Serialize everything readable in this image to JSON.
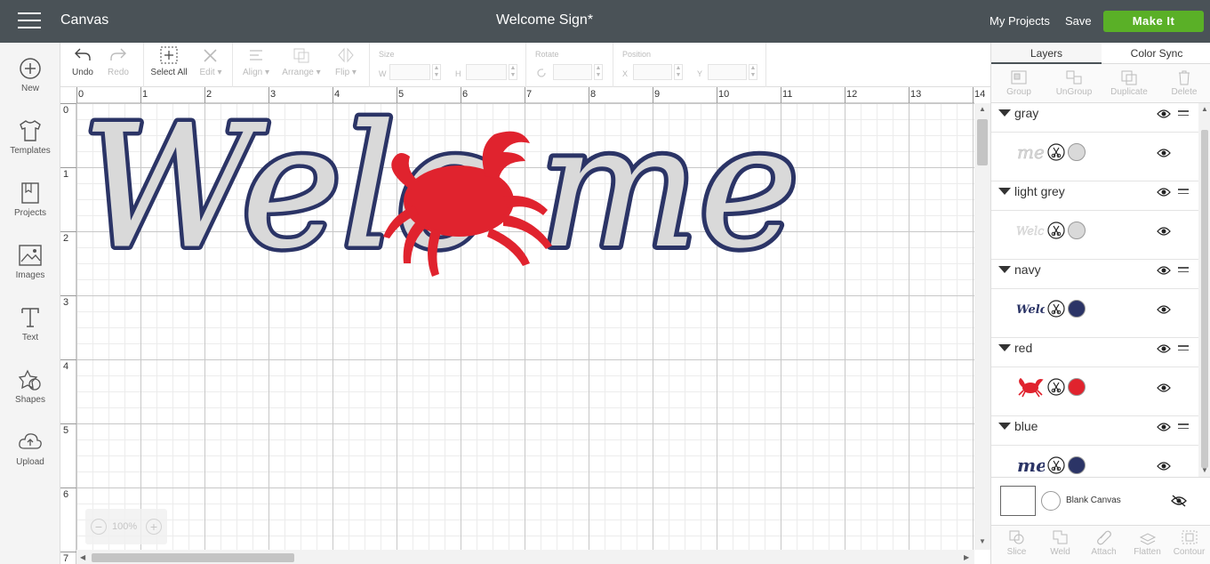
{
  "header": {
    "app_title": "Canvas",
    "doc_title": "Welcome Sign*",
    "my_projects": "My Projects",
    "save": "Save",
    "make_it": "Make It",
    "make_it_color": "#5ab027",
    "bar_color": "#4a5257"
  },
  "leftnav": {
    "items": [
      {
        "label": "New",
        "icon": "plus-circle-icon"
      },
      {
        "label": "Templates",
        "icon": "tshirt-icon"
      },
      {
        "label": "Projects",
        "icon": "projects-icon"
      },
      {
        "label": "Images",
        "icon": "image-icon"
      },
      {
        "label": "Text",
        "icon": "text-icon"
      },
      {
        "label": "Shapes",
        "icon": "shapes-icon"
      },
      {
        "label": "Upload",
        "icon": "upload-cloud-icon"
      }
    ]
  },
  "toolbar": {
    "undo": "Undo",
    "redo": "Redo",
    "select_all": "Select All",
    "edit": "Edit",
    "align": "Align",
    "arrange": "Arrange",
    "flip": "Flip",
    "size": "Size",
    "w": "W",
    "h": "H",
    "rotate": "Rotate",
    "position": "Position",
    "x": "X",
    "y": "Y"
  },
  "canvas": {
    "ruler_h": [
      "0",
      "1",
      "2",
      "3",
      "4",
      "5",
      "6",
      "7",
      "8",
      "9",
      "10",
      "11",
      "12",
      "13",
      "14"
    ],
    "ruler_v": [
      "0",
      "1",
      "2",
      "3",
      "4",
      "5",
      "6",
      "7"
    ],
    "zoom": "100%",
    "design_text": "Welcome",
    "colors": {
      "gray": "#d9d9d9",
      "navy": "#2b3466",
      "red": "#e0232e"
    }
  },
  "rightpanel": {
    "tab_layers": "Layers",
    "tab_color_sync": "Color Sync",
    "tools": {
      "group": "Group",
      "ungroup": "UnGroup",
      "duplicate": "Duplicate",
      "delete": "Delete"
    },
    "groups": [
      {
        "name": "gray",
        "thumb": "me",
        "color": "#d9d9d9"
      },
      {
        "name": "light grey",
        "thumb": "Welc",
        "color": "#d9d9d9"
      },
      {
        "name": "navy",
        "thumb": "Welc",
        "color": "#2b3466"
      },
      {
        "name": "red",
        "thumb": "crab",
        "color": "#e0232e"
      },
      {
        "name": "blue",
        "thumb": "me",
        "color": "#2b3466"
      }
    ],
    "blank_canvas": "Blank Canvas",
    "bottom_tools": {
      "slice": "Slice",
      "weld": "Weld",
      "attach": "Attach",
      "flatten": "Flatten",
      "contour": "Contour"
    }
  }
}
